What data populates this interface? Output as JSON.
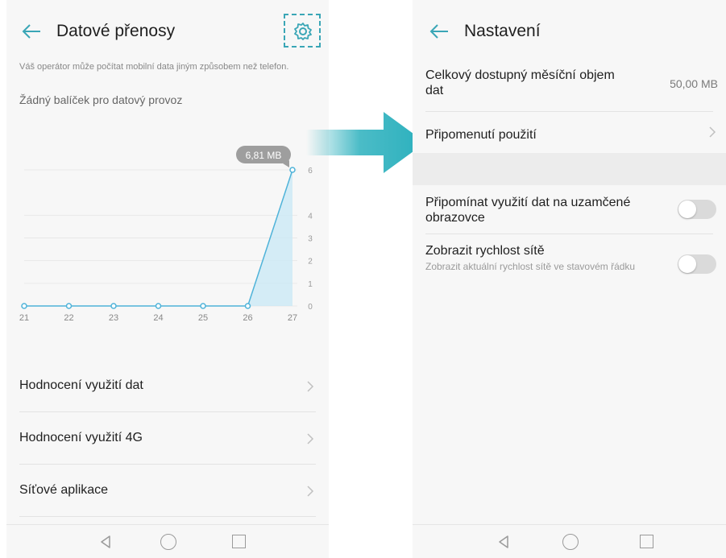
{
  "left_screen": {
    "title": "Datové přenosy",
    "back_icon": "back-arrow-icon",
    "settings_icon": "gear-icon",
    "note": "Váš operátor může počítat mobilní data jiným způsobem než telefon.",
    "plan_status": "Žádný balíček pro datový provoz",
    "usage_bubble": "6,81 MB",
    "menu": [
      {
        "label": "Hodnocení využití dat"
      },
      {
        "label": "Hodnocení využití 4G"
      },
      {
        "label": "Síťové aplikace"
      }
    ]
  },
  "right_screen": {
    "title": "Nastavení",
    "monthly_limit_label": "Celkový dostupný měsíční objem dat",
    "monthly_limit_value": "50,00 MB",
    "reminder_label": "Připomenutí použití",
    "lockscreen_label": "Připomínat využití dat na uzamčené obrazovce",
    "lockscreen_enabled": false,
    "speed_label": "Zobrazit rychlost sítě",
    "speed_sublabel": "Zobrazit aktuální rychlost sítě ve stavovém řádku",
    "speed_enabled": false
  },
  "chart_data": {
    "type": "area",
    "x": [
      "21",
      "22",
      "23",
      "24",
      "25",
      "26",
      "27"
    ],
    "y": [
      0,
      0,
      0,
      0,
      0,
      0,
      6.81
    ],
    "y_ticks": [
      "0",
      "1",
      "2",
      "3",
      "4",
      "6"
    ],
    "ylim": [
      0,
      6
    ],
    "annotation": "6,81 MB",
    "grid": true,
    "color": "#4fb3d9"
  },
  "colors": {
    "accent": "#3aa6b6",
    "arrow": "#2bb0bd",
    "chart_line": "#4fb3d9",
    "chart_fill": "#cbe9f5"
  },
  "navigation": {
    "back_icon": "nav-back-icon",
    "home_icon": "nav-home-icon",
    "recent_icon": "nav-recent-icon"
  }
}
